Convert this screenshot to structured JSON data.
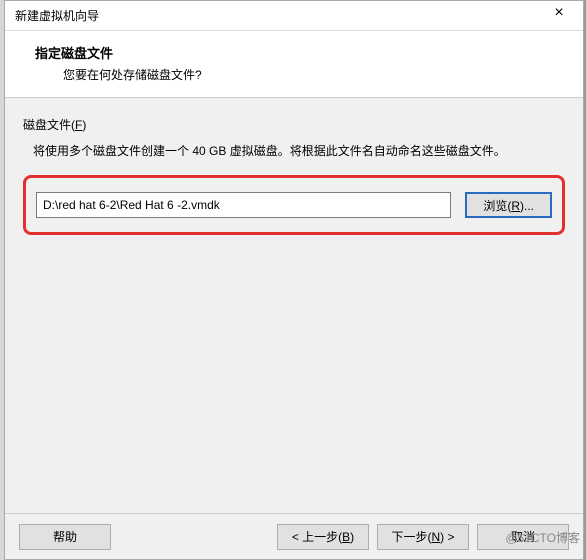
{
  "window": {
    "title": "新建虚拟机向导",
    "close_icon": "×"
  },
  "header": {
    "title": "指定磁盘文件",
    "subtitle": "您要在何处存储磁盘文件?"
  },
  "group": {
    "label_pre": "磁盘文件(",
    "label_u": "F",
    "label_post": ")",
    "description": "将使用多个磁盘文件创建一个 40 GB 虚拟磁盘。将根据此文件名自动命名这些磁盘文件。"
  },
  "input": {
    "path_value": "D:\\red hat 6-2\\Red Hat 6 -2.vmdk"
  },
  "buttons": {
    "browse_pre": "浏览(",
    "browse_u": "R",
    "browse_post": ")...",
    "help": "帮助",
    "back_pre": "< 上一步(",
    "back_u": "B",
    "back_post": ")",
    "next_pre": "下一步(",
    "next_u": "N",
    "next_post": ") >",
    "cancel": "取消"
  },
  "watermark": "@51CTO博客"
}
